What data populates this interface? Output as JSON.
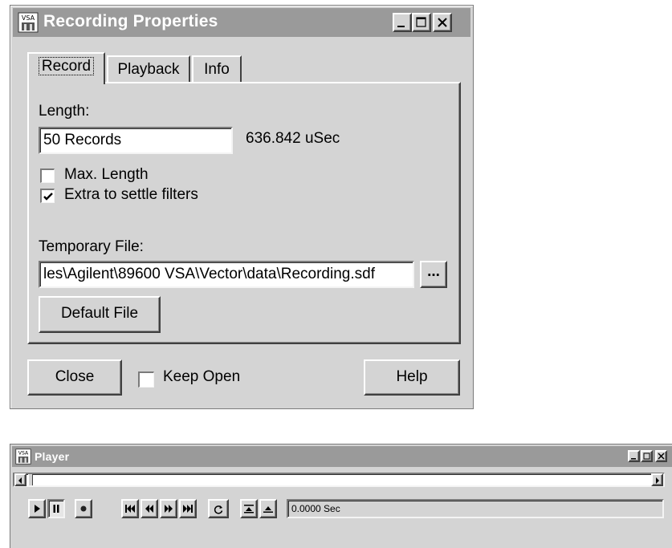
{
  "recording_window": {
    "title": "Recording Properties",
    "tabs": [
      {
        "label": "Record",
        "active": true
      },
      {
        "label": "Playback",
        "active": false
      },
      {
        "label": "Info",
        "active": false
      }
    ],
    "length_label": "Length:",
    "length_value": "50 Records",
    "length_time": "636.842 uSec",
    "max_length": {
      "label": "Max. Length",
      "checked": false
    },
    "extra_settle": {
      "label": "Extra to settle filters",
      "checked": true
    },
    "temp_file_label": "Temporary File:",
    "temp_file_value": "les\\Agilent\\89600 VSA\\Vector\\data\\Recording.sdf",
    "browse_label": "...",
    "default_file_label": "Default File",
    "close_label": "Close",
    "keep_open": {
      "label": "Keep Open",
      "checked": false
    },
    "help_label": "Help"
  },
  "player_window": {
    "title": "Player",
    "time_readout": "0.0000 Sec"
  },
  "icons": {
    "app": "vsa-app-icon",
    "minimize": "minimize-icon",
    "maximize": "maximize-icon",
    "close": "close-icon"
  }
}
